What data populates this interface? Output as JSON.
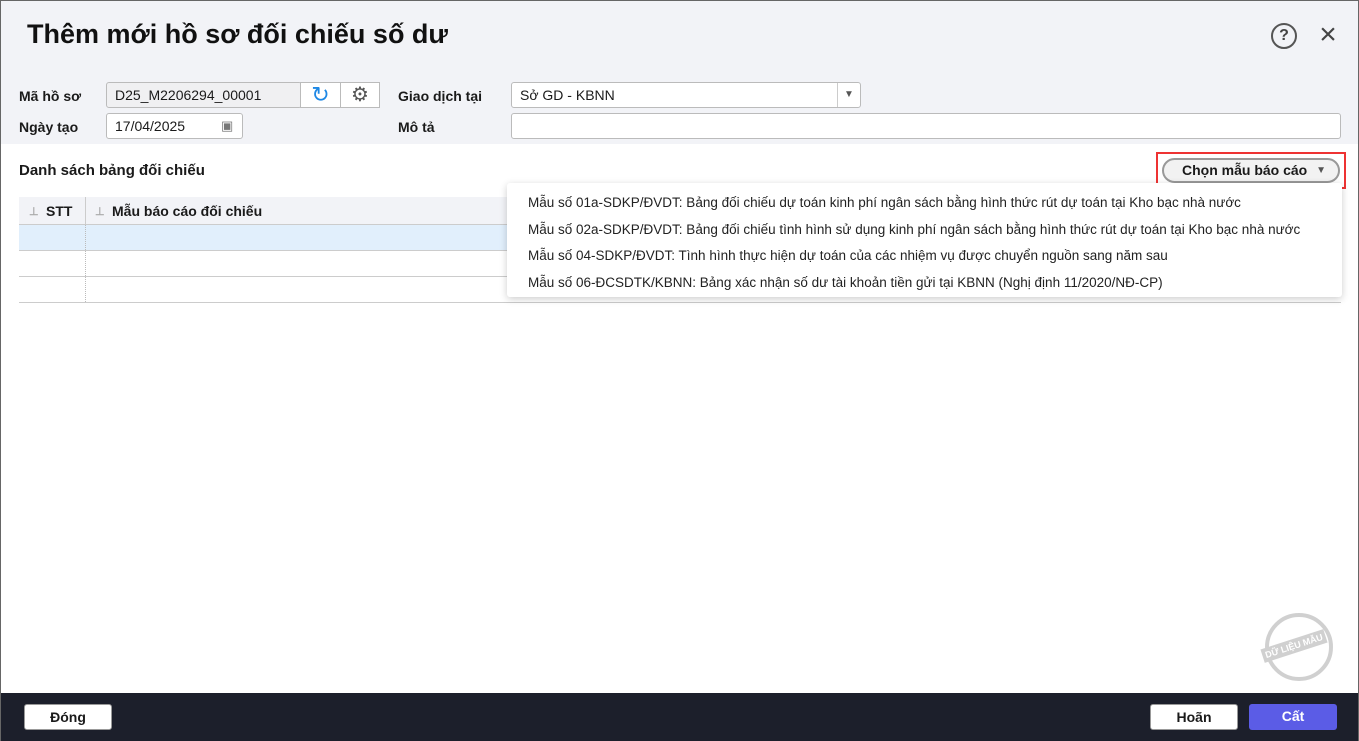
{
  "title": "Thêm mới hồ sơ đối chiếu số dư",
  "form": {
    "ma_ho_so_label": "Mã hồ sơ",
    "ma_ho_so": "D25_M2206294_00001",
    "ngay_tao_label": "Ngày tạo",
    "ngay_tao": "17/04/2025",
    "giao_dich_label": "Giao dịch tại",
    "giao_dich": "Sở GD - KBNN",
    "mo_ta_label": "Mô tả",
    "mo_ta": ""
  },
  "section": "Danh sách bảng đối chiếu",
  "table": {
    "headers": [
      "STT",
      "Mẫu báo cáo đối chiếu"
    ]
  },
  "chooser": "Chọn mẫu báo cáo",
  "menu": [
    "Mẫu số 01a-SDKP/ĐVDT: Bảng đối chiếu dự toán kinh phí ngân sách bằng hình thức rút dự toán tại Kho bạc nhà nước",
    "Mẫu số 02a-SDKP/ĐVDT: Bảng đối chiếu tình hình sử dụng kinh phí ngân sách bằng hình thức rút dự toán tại Kho bạc nhà nước",
    "Mẫu số 04-SDKP/ĐVDT: Tình hình thực hiện dự toán của các nhiệm vụ được chuyển nguồn sang năm sau",
    "Mẫu số 06-ĐCSDTK/KBNN: Bảng xác nhận số dư tài khoản tiền gửi tại KBNN (Nghị định 11/2020/NĐ-CP)"
  ],
  "stamp": "DỮ LIỆU MẪU",
  "footer": {
    "close": "Đóng",
    "cancel": "Hoãn",
    "save": "Cất"
  },
  "colors": {
    "accent": "#5b5ce6",
    "footer": "#1c1f2b",
    "highlight": "#e33"
  }
}
